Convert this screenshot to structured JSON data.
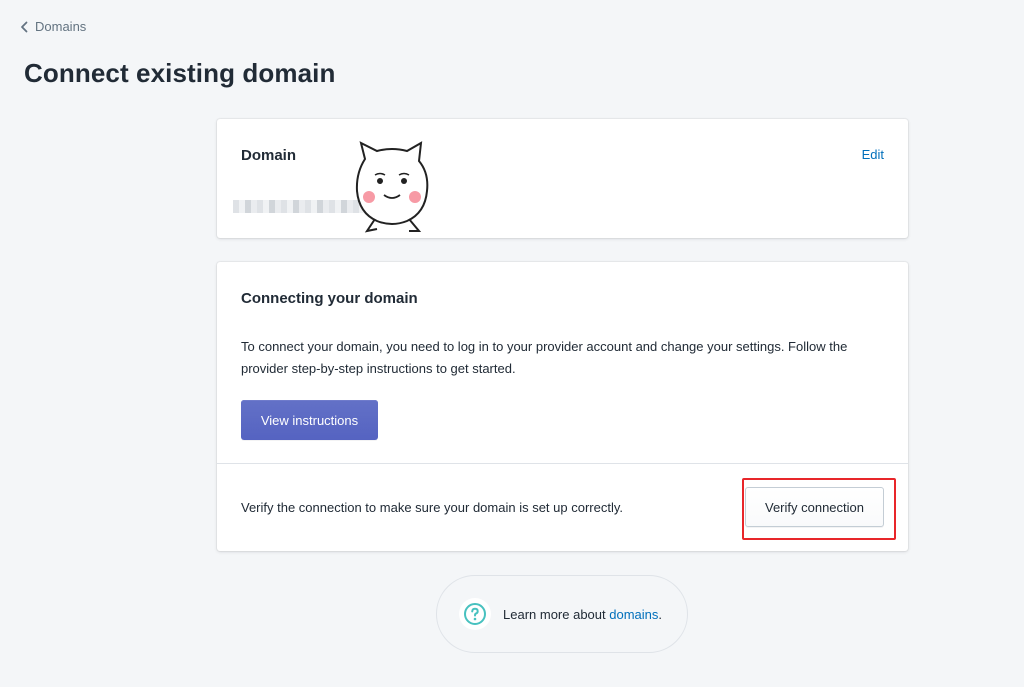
{
  "breadcrumb": {
    "label": "Domains",
    "icon": "chevron-left-icon"
  },
  "page": {
    "title": "Connect existing domain"
  },
  "domain_card": {
    "heading": "Domain",
    "edit_label": "Edit"
  },
  "connect_card": {
    "heading": "Connecting your domain",
    "description": "To connect your domain, you need to log in to your provider account and change your settings. Follow the provider step-by-step instructions to get started.",
    "instructions_button": "View instructions",
    "verify_text": "Verify the connection to make sure your domain is set up correctly.",
    "verify_button": "Verify connection"
  },
  "footer": {
    "prefix": "Learn more about",
    "link": "domains",
    "suffix": ".",
    "icon": "question-circle-icon"
  },
  "colors": {
    "primary": "#5c6ac4",
    "link": "#006fbb",
    "highlight": "#e8262a",
    "help_icon": "#47c1bf"
  }
}
